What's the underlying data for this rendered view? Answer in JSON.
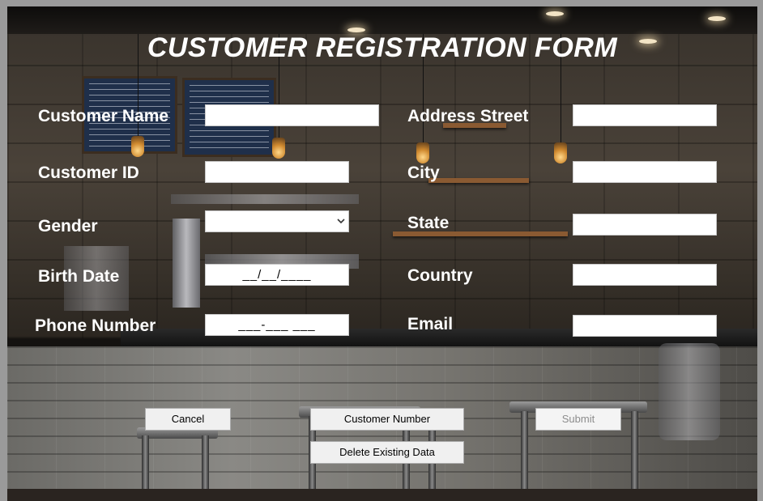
{
  "form": {
    "title": "CUSTOMER REGISTRATION FORM",
    "left_fields": [
      {
        "label": "Customer Name",
        "value": ""
      },
      {
        "label": "Customer ID",
        "value": ""
      },
      {
        "label": "Gender",
        "value": ""
      },
      {
        "label": "Birth Date",
        "mask": "__/__/____"
      },
      {
        "label": "Phone Number",
        "mask": "___-___ ___"
      }
    ],
    "right_fields": [
      {
        "label": "Address Street",
        "value": ""
      },
      {
        "label": "City",
        "value": ""
      },
      {
        "label": "State",
        "value": ""
      },
      {
        "label": "Country",
        "value": ""
      },
      {
        "label": "Email",
        "value": ""
      }
    ],
    "buttons": {
      "cancel": "Cancel",
      "customer_number": "Customer Number",
      "submit": "Submit",
      "delete": "Delete Existing Data"
    },
    "icons": {
      "gender_dropdown": "chevron-down-icon"
    }
  }
}
